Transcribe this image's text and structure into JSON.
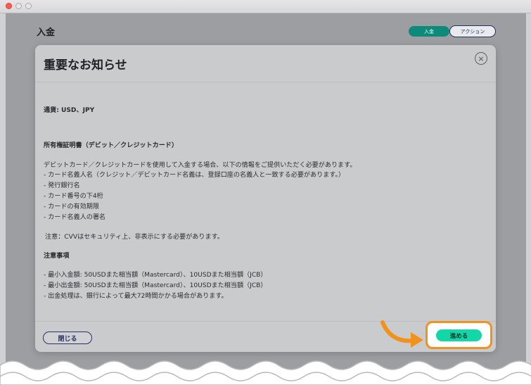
{
  "header": {
    "title": "入金",
    "tab_deposit": "入金",
    "tab_action": "アクション"
  },
  "modal": {
    "title": "重要なお知らせ",
    "close_icon": "×",
    "currency_line": "通貨: USD、JPY",
    "proof_heading": "所有権証明書（デビット／クレジットカード）",
    "proof_intro": "デビットカード／クレジットカードを使用して入金する場合、以下の情報をご提供いただく必要があります。",
    "proof_items": [
      "- カード名義人名（クレジット／デビットカード名義は、登録口座の名義人と一致する必要があります。）",
      "- 発行銀行名",
      "- カード番号の下4桁",
      "- カードの有効期限",
      "- カード名義人の署名"
    ],
    "cvv_note": "注意：CVVはセキュリティ上、非表示にする必要があります。",
    "notes_heading": "注意事項",
    "notes_items": [
      "- 最小入金額: 50USDまた相当額（Mastercard）、10USDまた相当額（JCB）",
      "- 最小出金額: 50USDまた相当額（Mastercard）、10USDまた相当額（JCB）",
      "- 出金処理は、銀行によって最大72時間かかる場合があります。"
    ],
    "close_button": "閉じる",
    "proceed_button": "進める"
  },
  "colors": {
    "accent_teal": "#13d7a6",
    "deposit_tab": "#0d8a79",
    "highlight_orange": "#f0921d",
    "navy": "#272f57"
  },
  "icons": {
    "close": "close-circle-icon",
    "pointer": "curved-arrow-icon"
  }
}
